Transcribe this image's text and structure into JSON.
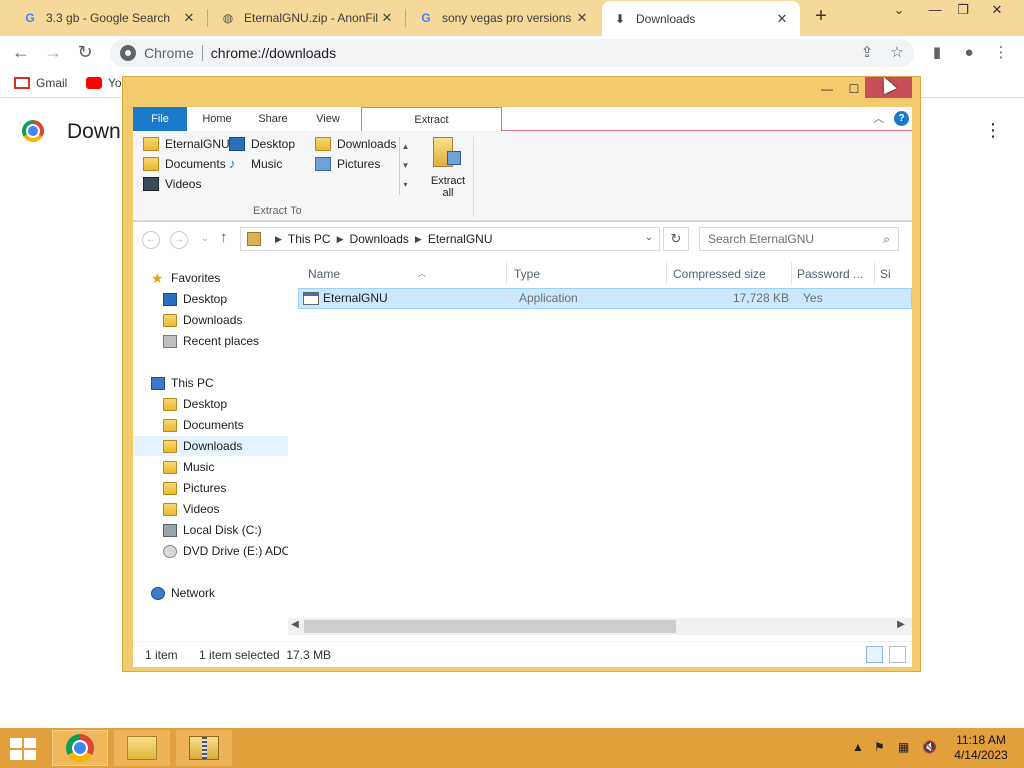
{
  "browser": {
    "tabs": [
      {
        "label": "3.3 gb - Google Search",
        "icon": "google-icon",
        "active": false
      },
      {
        "label": "EternalGNU.zip - AnonFil",
        "icon": "globe-icon",
        "active": false
      },
      {
        "label": "sony vegas pro versions",
        "icon": "google-icon",
        "active": false
      },
      {
        "label": "Downloads",
        "icon": "download-icon",
        "active": true
      }
    ],
    "new_tab": "+",
    "omnibox": {
      "chip": "Chrome",
      "url": "chrome://downloads"
    },
    "bookmarks": [
      {
        "label": "Gmail",
        "icon": "gmail-icon"
      },
      {
        "label": "YouTube",
        "icon": "youtube-icon"
      }
    ],
    "page_title": "Downloads"
  },
  "explorer": {
    "ribbon_tabs": {
      "file": "File",
      "home": "Home",
      "share": "Share",
      "view": "View",
      "extract": "Extract"
    },
    "ribbon_places": [
      {
        "label": "EternalGNU",
        "icon": "folder-icon"
      },
      {
        "label": "Desktop",
        "icon": "desktop-icon"
      },
      {
        "label": "Downloads",
        "icon": "folder-icon"
      },
      {
        "label": "Documents",
        "icon": "folder-icon"
      },
      {
        "label": "Music",
        "icon": "music-icon"
      },
      {
        "label": "Pictures",
        "icon": "pictures-icon"
      },
      {
        "label": "Videos",
        "icon": "videos-icon"
      }
    ],
    "extract_all": {
      "line1": "Extract",
      "line2": "all"
    },
    "extract_to_label": "Extract To",
    "address": {
      "crumbs": [
        "This PC",
        "Downloads",
        "EternalGNU"
      ],
      "search_placeholder": "Search EternalGNU"
    },
    "nav": {
      "favorites": "Favorites",
      "fav_items": [
        "Desktop",
        "Downloads",
        "Recent places"
      ],
      "this_pc": "This PC",
      "pc_items": [
        "Desktop",
        "Documents",
        "Downloads",
        "Music",
        "Pictures",
        "Videos",
        "Local Disk (C:)",
        "DVD Drive (E:) ADOBE"
      ],
      "network": "Network",
      "selected": "Downloads"
    },
    "columns": {
      "name": "Name",
      "type": "Type",
      "compressed": "Compressed size",
      "password": "Password ...",
      "size": "Si"
    },
    "files": [
      {
        "name": "EternalGNU",
        "type": "Application",
        "compressed": "17,728 KB",
        "password": "Yes",
        "selected": true
      }
    ],
    "status": {
      "count": "1 item",
      "selected": "1 item selected  17.3 MB"
    }
  },
  "taskbar": {
    "clock_time": "11:18 AM",
    "clock_date": "4/14/2023"
  }
}
